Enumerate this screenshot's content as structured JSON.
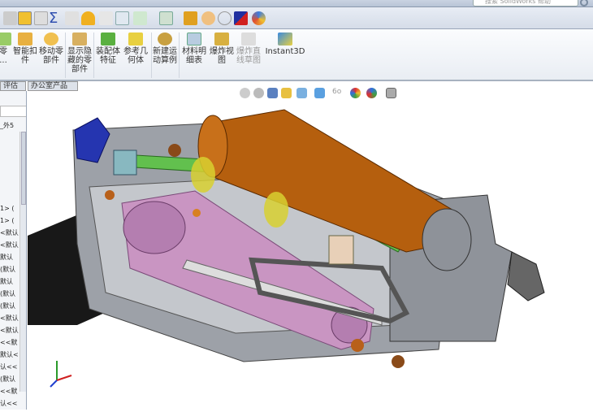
{
  "search": {
    "placeholder": "搜索 SolidWorks 帮助"
  },
  "ribbon": {
    "items": [
      {
        "label": "零\n..."
      },
      {
        "label": "智能扣\n件"
      },
      {
        "label": "移动零\n部件"
      },
      {
        "label": "显示隐\n藏的零\n部件"
      },
      {
        "label": "装配体\n特征"
      },
      {
        "label": "参考几\n何体"
      },
      {
        "label": "新建运\n动算例"
      },
      {
        "label": "材料明\n细表"
      },
      {
        "label": "爆炸视\n图"
      },
      {
        "label": "爆炸直\n线草图"
      },
      {
        "label": "Instant3D"
      }
    ]
  },
  "tabs": [
    {
      "label": "评估"
    },
    {
      "label": "办公室产品"
    }
  ],
  "tree": {
    "items": [
      "_外5",
      "1> (",
      "1> (",
      "<默认",
      "<默认",
      "默认",
      "(默认",
      "默认",
      "(默认",
      "(默认",
      "<默认",
      "<默认",
      "<<默",
      "默认<",
      "认<<",
      "(默认",
      "<<默",
      "认<<"
    ]
  },
  "colors": {
    "motor": "#b35a0c",
    "frame": "#8a8f99",
    "belt": "#c08ab8",
    "bracket": "#6fbf5a",
    "clamp": "#2030a8",
    "stepper": "#1a1a1a"
  }
}
